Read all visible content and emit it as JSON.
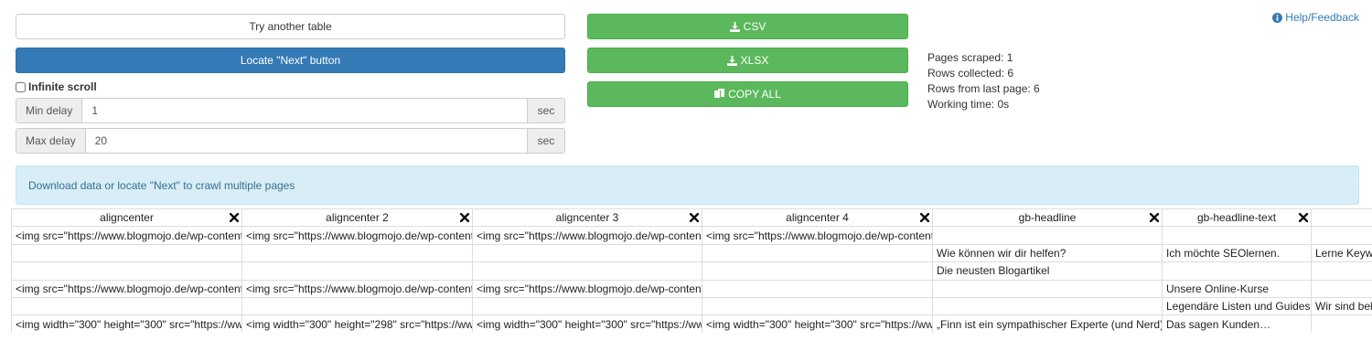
{
  "controls": {
    "try_another_label": "Try another table",
    "locate_next_label": "Locate \"Next\" button",
    "infinite_scroll_label": "Infinite scroll",
    "min_delay": {
      "label": "Min delay",
      "value": "1",
      "unit": "sec"
    },
    "max_delay": {
      "label": "Max delay",
      "value": "20",
      "unit": "sec"
    }
  },
  "export": {
    "csv_label": "CSV",
    "xlsx_label": "XLSX",
    "copy_label": "COPY ALL"
  },
  "stats": {
    "pages_scraped": "Pages scraped: 1",
    "rows_collected": "Rows collected: 6",
    "rows_last_page": "Rows from last page: 6",
    "working_time": "Working time: 0s"
  },
  "help": {
    "label": "Help/Feedback"
  },
  "alert": {
    "text": "Download data or locate \"Next\" to crawl multiple pages"
  },
  "table": {
    "columns": [
      "aligncenter",
      "aligncenter 2",
      "aligncenter 3",
      "aligncenter 4",
      "gb-headline",
      "gb-headline-text",
      ""
    ],
    "rows": [
      [
        "<img src=\"https://www.blogmojo.de/wp-content",
        "<img src=\"https://www.blogmojo.de/wp-content",
        "<img src=\"https://www.blogmojo.de/wp-content",
        "<img src=\"https://www.blogmojo.de/wp-content",
        "",
        "",
        ""
      ],
      [
        "",
        "",
        "",
        "",
        "Wie können wir dir helfen?",
        "Ich möchte SEOlernen.",
        "Lerne Keyw"
      ],
      [
        "",
        "",
        "",
        "",
        "Die neusten Blogartikel",
        "",
        ""
      ],
      [
        "<img src=\"https://www.blogmojo.de/wp-content",
        "<img src=\"https://www.blogmojo.de/wp-content",
        "<img src=\"https://www.blogmojo.de/wp-content",
        "",
        "",
        "Unsere Online-Kurse",
        ""
      ],
      [
        "",
        "",
        "",
        "",
        "",
        "Legendäre Listen und Guides",
        "Wir sind bek"
      ],
      [
        "<img width=\"300\" height=\"300\" src=\"https://www",
        "<img width=\"300\" height=\"298\" src=\"https://www",
        "<img width=\"300\" height=\"300\" src=\"https://www",
        "<img width=\"300\" height=\"300\" src=\"https://www",
        "„Finn ist ein sympathischer Experte (und Nerd),",
        "Das sagen Kunden…",
        ""
      ]
    ]
  },
  "colors": {
    "primary": "#337ab7",
    "success": "#5cb85c",
    "info_bg": "#d9edf7",
    "info_text": "#31708f"
  },
  "icons": {
    "csv": "download-icon",
    "xlsx": "download-icon",
    "copy": "copy-icon",
    "help": "info-circle-icon",
    "remove_column": "close-icon"
  }
}
